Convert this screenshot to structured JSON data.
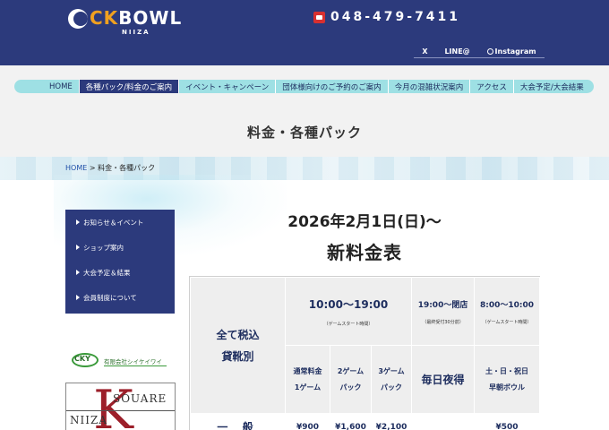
{
  "header": {
    "logo_ck": "CK",
    "logo_bowl": "BOWL",
    "logo_sub": "NIIZA",
    "phone": "048-479-7411",
    "sns": [
      "X",
      "LINE@",
      "Instagram"
    ]
  },
  "nav": {
    "items": [
      "HOME",
      "各種パック/料金のご案内",
      "イベント・キャンペーン",
      "団体様向けのご予約のご案内",
      "今月の混雑状況案内",
      "アクセス",
      "大会予定/大会結果"
    ],
    "active_index": 1
  },
  "page_title": "料金・各種パック",
  "breadcrumb": {
    "home": "HOME",
    "sep": " > ",
    "current": "料金・各種パック"
  },
  "sidebar": {
    "items": [
      "お知らせ＆イベント",
      "ショップ案内",
      "大会予定＆結果",
      "会員制度について"
    ]
  },
  "banners": {
    "cky_logo": "CKY",
    "cky_name": "有限会社シイケイワイ",
    "square_top": "SOUARE",
    "square_bottom": "NIIZA",
    "square_letter": "K"
  },
  "main": {
    "date_heading": "2026年2月1日(日)〜",
    "price_title": "新料金表",
    "table": {
      "left_header_line1": "全て税込",
      "left_header_line2": "貸靴別",
      "time1": "10:00〜19:00",
      "time1_note": "（ゲームスタート時間）",
      "time2": "19:00〜閉店",
      "time2_note": "（最終受付30分前）",
      "time3": "8:00〜10:00",
      "time3_note": "（ゲームスタート時間）",
      "sub1_line1": "通常料金",
      "sub1_line2": "1ゲーム",
      "sub2_line1": "2ゲーム",
      "sub2_line2": "パック",
      "sub3_line1": "3ゲーム",
      "sub3_line2": "パック",
      "sub4": "毎日夜得",
      "sub5_line1": "土・日・祝日",
      "sub5_line2": "早朝ボウル",
      "row1_label": "一 般",
      "row1_values": [
        "¥900",
        "¥1,600",
        "¥2,100",
        "",
        "¥500"
      ]
    }
  }
}
